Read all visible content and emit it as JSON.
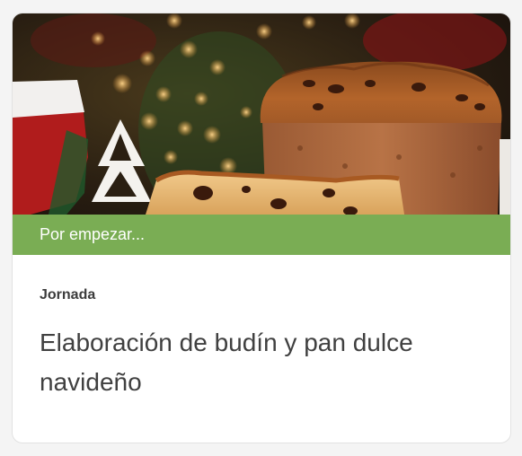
{
  "card": {
    "status_label": "Por empezar...",
    "category": "Jornada",
    "title": "Elaboración de budín y pan dulce navideño",
    "status_color": "#7aad54"
  },
  "image": {
    "icon": "panettone-photo"
  }
}
